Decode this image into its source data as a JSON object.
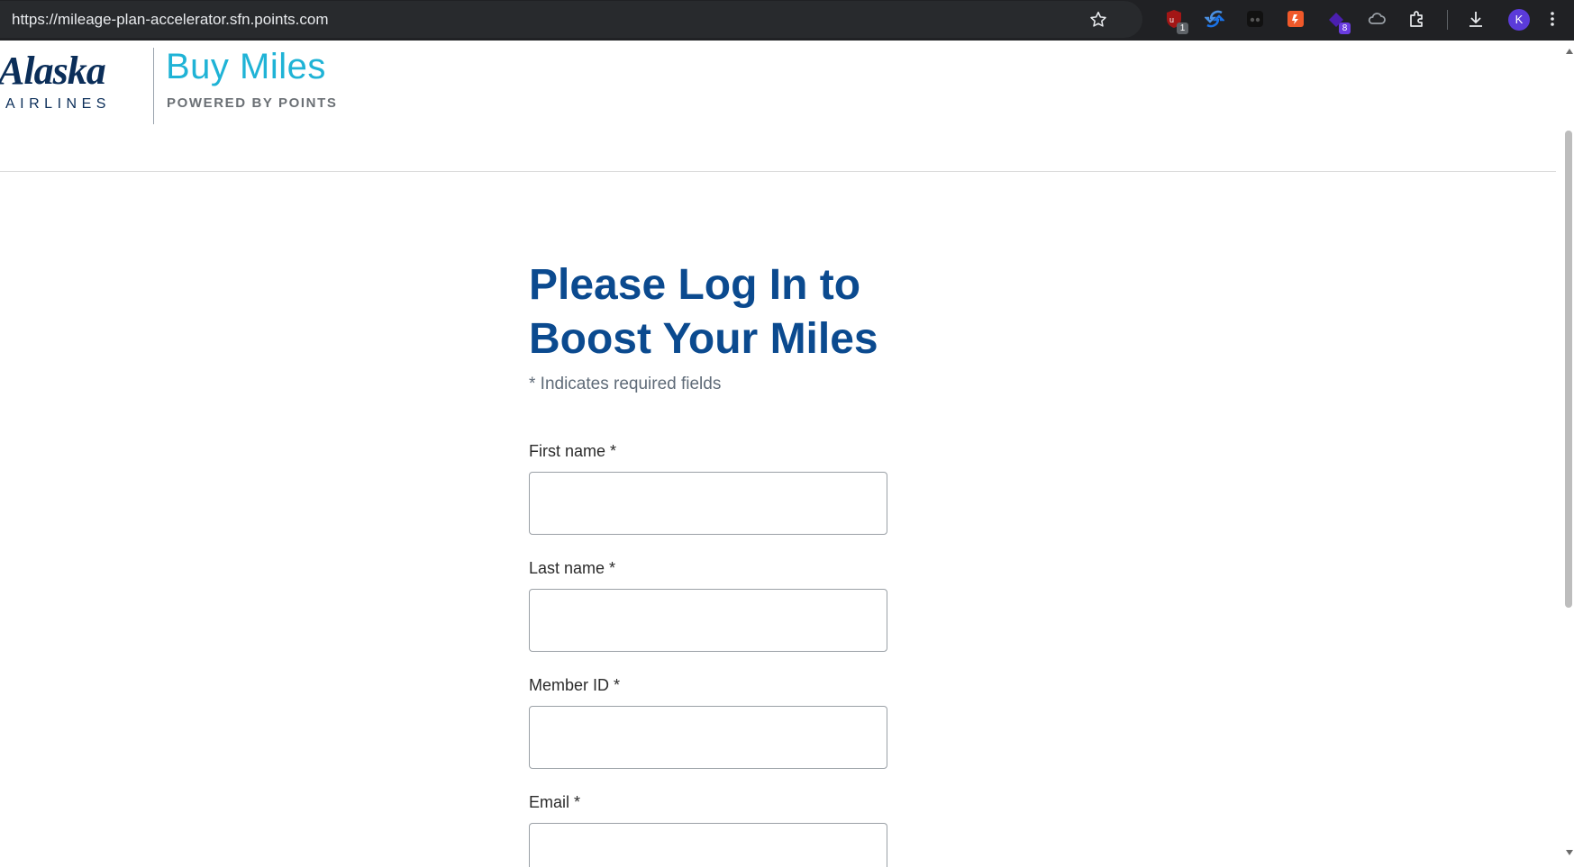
{
  "browser": {
    "url": "https://mileage-plan-accelerator.sfn.points.com",
    "extensions": [
      {
        "name": "ublock-icon",
        "badge": "1",
        "color": "#b31b1b",
        "badge_color": "#5f6368"
      },
      {
        "name": "sync-extension-icon",
        "badge": "",
        "color": "#1a73e8"
      },
      {
        "name": "mask-extension-icon",
        "badge": "",
        "color": "#000000"
      },
      {
        "name": "orange-extension-icon",
        "badge": "",
        "color": "#f0592a"
      },
      {
        "name": "purple-extension-icon",
        "badge": "8",
        "color": "#5b2bd6",
        "badge_color": "#6a3ce0"
      },
      {
        "name": "cloud-extension-icon",
        "badge": "",
        "color": "#9aa0a6"
      }
    ],
    "avatar_initial": "K"
  },
  "header": {
    "logo_word": "Alaska",
    "logo_sub": "AIRLINES",
    "product_title": "Buy Miles",
    "powered_by": "POWERED BY POINTS"
  },
  "form": {
    "title": "Please Log In to Boost Your Miles",
    "required_note": "* Indicates required fields",
    "fields": [
      {
        "label": "First name *",
        "value": "",
        "placeholder": ""
      },
      {
        "label": "Last name *",
        "value": "",
        "placeholder": ""
      },
      {
        "label": "Member ID *",
        "value": "",
        "placeholder": ""
      },
      {
        "label": "Email *",
        "value": "",
        "placeholder": ""
      }
    ]
  },
  "colors": {
    "title_blue": "#0b4a8f",
    "brand_cyan": "#1fb3d6",
    "alaska_navy": "#0b2e59"
  }
}
